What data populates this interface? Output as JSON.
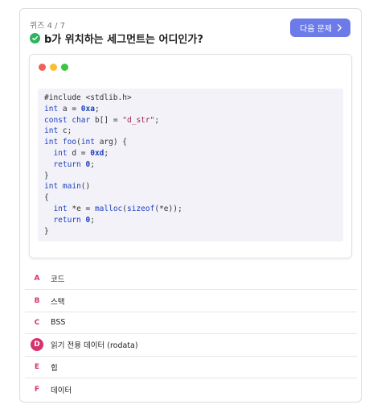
{
  "quiz": {
    "progress": "퀴즈 4 / 7",
    "question": "b가 위치하는 세그먼트는 어디인가?",
    "next_label": "다음 문제"
  },
  "window_dots": [
    "#f25f58",
    "#fbbe2e",
    "#3ac640"
  ],
  "code": {
    "lines": [
      "#include <stdlib.h>",
      "int a = 0xa;",
      "const char b[] = \"d_str\";",
      "int c;",
      "int foo(int arg) {",
      "  int d = 0xd;",
      "  return 0;",
      "}",
      "int main()",
      "{",
      "  int *e = malloc(sizeof(*e));",
      "  return 0;",
      "}"
    ]
  },
  "options": [
    {
      "letter": "A",
      "label": "코드",
      "selected": false
    },
    {
      "letter": "B",
      "label": "스택",
      "selected": false
    },
    {
      "letter": "C",
      "label": "BSS",
      "selected": false
    },
    {
      "letter": "D",
      "label": "읽기 전용 데이터 (rodata)",
      "selected": true
    },
    {
      "letter": "E",
      "label": "힙",
      "selected": false
    },
    {
      "letter": "F",
      "label": "데이터",
      "selected": false
    }
  ],
  "colors": {
    "accent": "#6c7be8",
    "correct": "#2fb35c",
    "option_letter": "#d6336c"
  }
}
